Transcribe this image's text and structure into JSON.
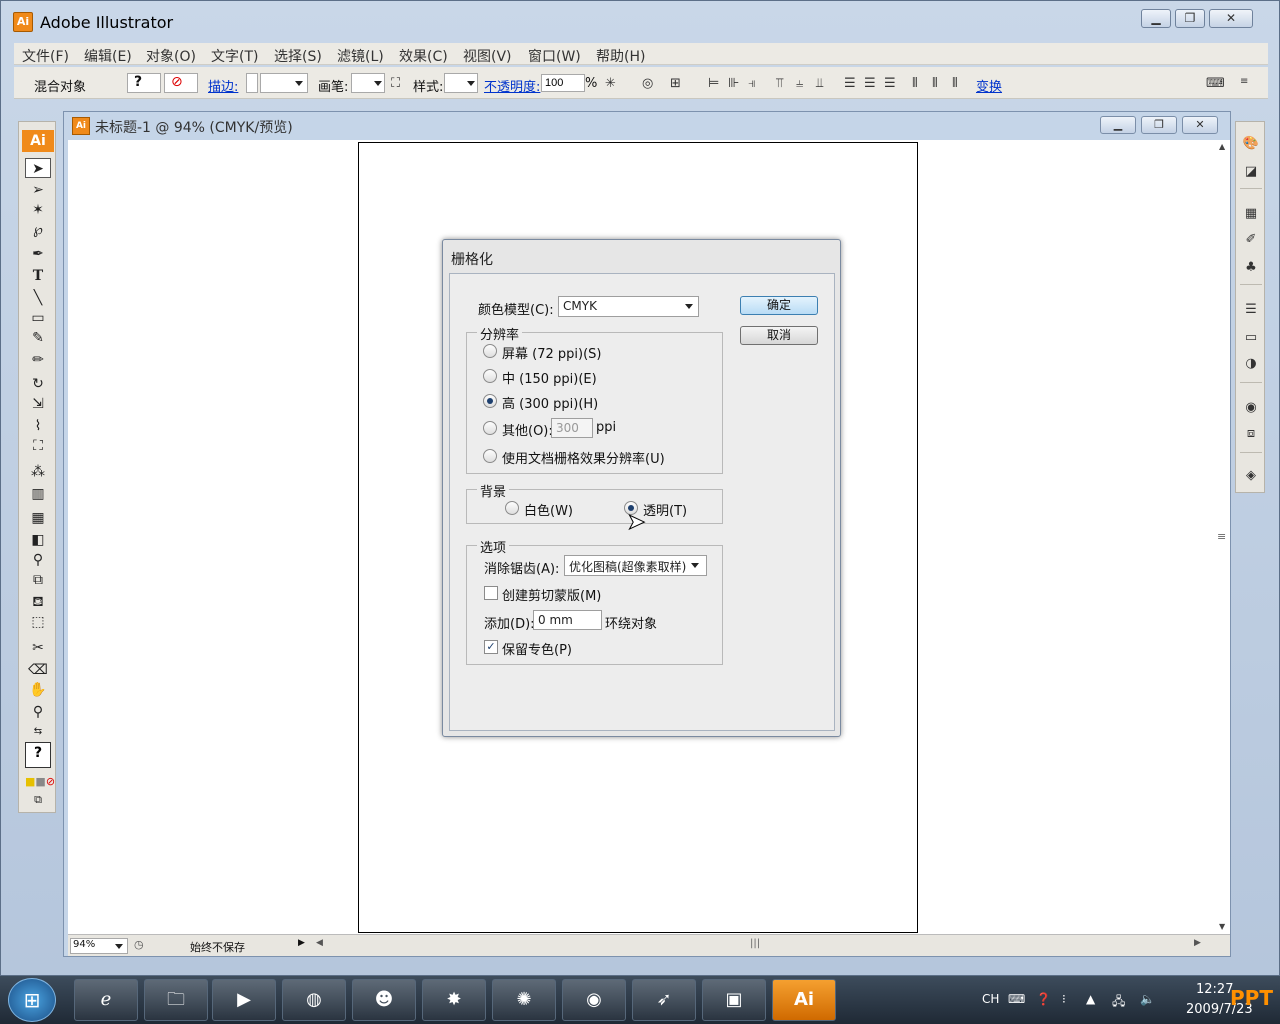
{
  "app": {
    "title": "Adobe Illustrator",
    "icon_label": "Ai"
  },
  "menu": [
    "文件(F)",
    "编辑(E)",
    "对象(O)",
    "文字(T)",
    "选择(S)",
    "滤镜(L)",
    "效果(C)",
    "视图(V)",
    "窗口(W)",
    "帮助(H)"
  ],
  "control": {
    "object_type": "混合对象",
    "stroke_label": "描边:",
    "brush_label": "画笔:",
    "style_label": "样式:",
    "opacity_label": "不透明度:",
    "opacity_value": "100",
    "opacity_unit": "%",
    "transform_link": "变换",
    "fill_glyph": "?"
  },
  "document": {
    "title": "未标题-1 @ 94% (CMYK/预览)",
    "icon_label": "Ai",
    "zoom": "94%",
    "save_status": "始终不保存"
  },
  "dialog": {
    "title": "栅格化",
    "color_model_label": "颜色模型(C):",
    "color_model_value": "CMYK",
    "ok": "确定",
    "cancel": "取消",
    "resolution_group": "分辨率",
    "res_screen": "屏幕 (72 ppi)(S)",
    "res_medium": "中 (150 ppi)(E)",
    "res_high": "高 (300 ppi)(H)",
    "res_other": "其他(O):",
    "res_other_value": "300",
    "res_other_unit": "ppi",
    "res_document": "使用文档栅格效果分辨率(U)",
    "background_group": "背景",
    "bg_white": "白色(W)",
    "bg_transparent": "透明(T)",
    "options_group": "选项",
    "antialias_label": "消除锯齿(A):",
    "antialias_value": "优化图稿(超像素取样)",
    "clipping_mask": "创建剪切蒙版(M)",
    "add_label": "添加(D):",
    "add_value": "0 mm",
    "add_suffix": "环绕对象",
    "preserve_spot": "保留专色(P)",
    "selected_resolution": "high",
    "selected_background": "transparent",
    "clipping_mask_checked": false,
    "preserve_spot_checked": true
  },
  "taskbar": {
    "ai_label": "Ai",
    "lang": "CH",
    "clock_time": "12:27",
    "clock_date": "2009/7/23",
    "watermark": "PPT"
  },
  "colors": {
    "accent": "#f08a1a",
    "link": "#0033cc",
    "frame": "#c9d7e8"
  }
}
